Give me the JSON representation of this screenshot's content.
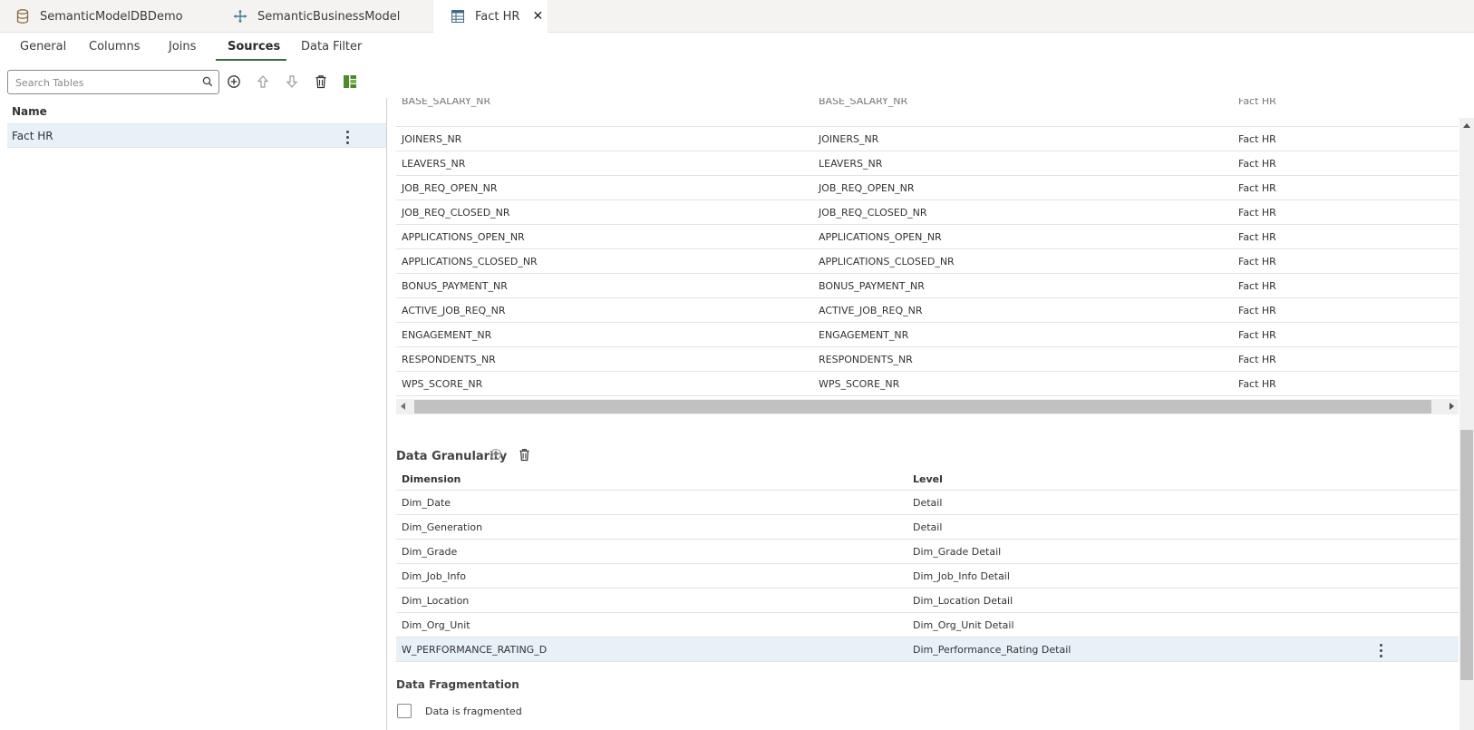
{
  "doc_tabs": [
    {
      "label": "SemanticModelDBDemo",
      "icon": "database-icon"
    },
    {
      "label": "SemanticBusinessModel",
      "icon": "move-arrows-icon"
    },
    {
      "label": "Fact HR",
      "icon": "table-icon",
      "active": true,
      "close": "✕"
    }
  ],
  "sub_tabs": [
    {
      "label": "General"
    },
    {
      "label": "Columns"
    },
    {
      "label": "Joins"
    },
    {
      "label": "Sources",
      "active": true
    },
    {
      "label": "Data Filter"
    }
  ],
  "search": {
    "placeholder": "Search Tables",
    "value": ""
  },
  "toolbar": {
    "icons": [
      "add-icon",
      "move-up-icon",
      "move-down-icon",
      "delete-icon",
      "table-layout-icon"
    ]
  },
  "left_table": {
    "header": "Name",
    "rows": [
      {
        "name": "Fact HR"
      }
    ]
  },
  "source_columns": {
    "partial_row": [
      "BASE_SALARY_NR",
      "BASE_SALARY_NR",
      "Fact HR"
    ],
    "rows": [
      [
        "JOINERS_NR",
        "JOINERS_NR",
        "Fact HR"
      ],
      [
        "LEAVERS_NR",
        "LEAVERS_NR",
        "Fact HR"
      ],
      [
        "JOB_REQ_OPEN_NR",
        "JOB_REQ_OPEN_NR",
        "Fact HR"
      ],
      [
        "JOB_REQ_CLOSED_NR",
        "JOB_REQ_CLOSED_NR",
        "Fact HR"
      ],
      [
        "APPLICATIONS_OPEN_NR",
        "APPLICATIONS_OPEN_NR",
        "Fact HR"
      ],
      [
        "APPLICATIONS_CLOSED_NR",
        "APPLICATIONS_CLOSED_NR",
        "Fact HR"
      ],
      [
        "BONUS_PAYMENT_NR",
        "BONUS_PAYMENT_NR",
        "Fact HR"
      ],
      [
        "ACTIVE_JOB_REQ_NR",
        "ACTIVE_JOB_REQ_NR",
        "Fact HR"
      ],
      [
        "ENGAGEMENT_NR",
        "ENGAGEMENT_NR",
        "Fact HR"
      ],
      [
        "RESPONDENTS_NR",
        "RESPONDENTS_NR",
        "Fact HR"
      ],
      [
        "WPS_SCORE_NR",
        "WPS_SCORE_NR",
        "Fact HR"
      ]
    ]
  },
  "granularity": {
    "title": "Data Granularity",
    "headers": {
      "dimension": "Dimension",
      "level": "Level"
    },
    "rows": [
      {
        "dimension": "Dim_Date",
        "level": "Detail"
      },
      {
        "dimension": "Dim_Generation",
        "level": "Detail"
      },
      {
        "dimension": "Dim_Grade",
        "level": "Dim_Grade Detail"
      },
      {
        "dimension": "Dim_Job_Info",
        "level": "Dim_Job_Info Detail"
      },
      {
        "dimension": "Dim_Location",
        "level": "Dim_Location Detail"
      },
      {
        "dimension": "Dim_Org_Unit",
        "level": "Dim_Org_Unit Detail"
      },
      {
        "dimension": "W_PERFORMANCE_RATING_D",
        "level": "Dim_Performance_Rating Detail",
        "selected": true
      }
    ]
  },
  "fragmentation": {
    "title": "Data Fragmentation",
    "checkbox_label": "Data is fragmented",
    "checked": false
  },
  "colors": {
    "accent": "#3a6b3e",
    "selected_row": "#e8f1f8",
    "tab_bar": "#f4f3f2"
  }
}
